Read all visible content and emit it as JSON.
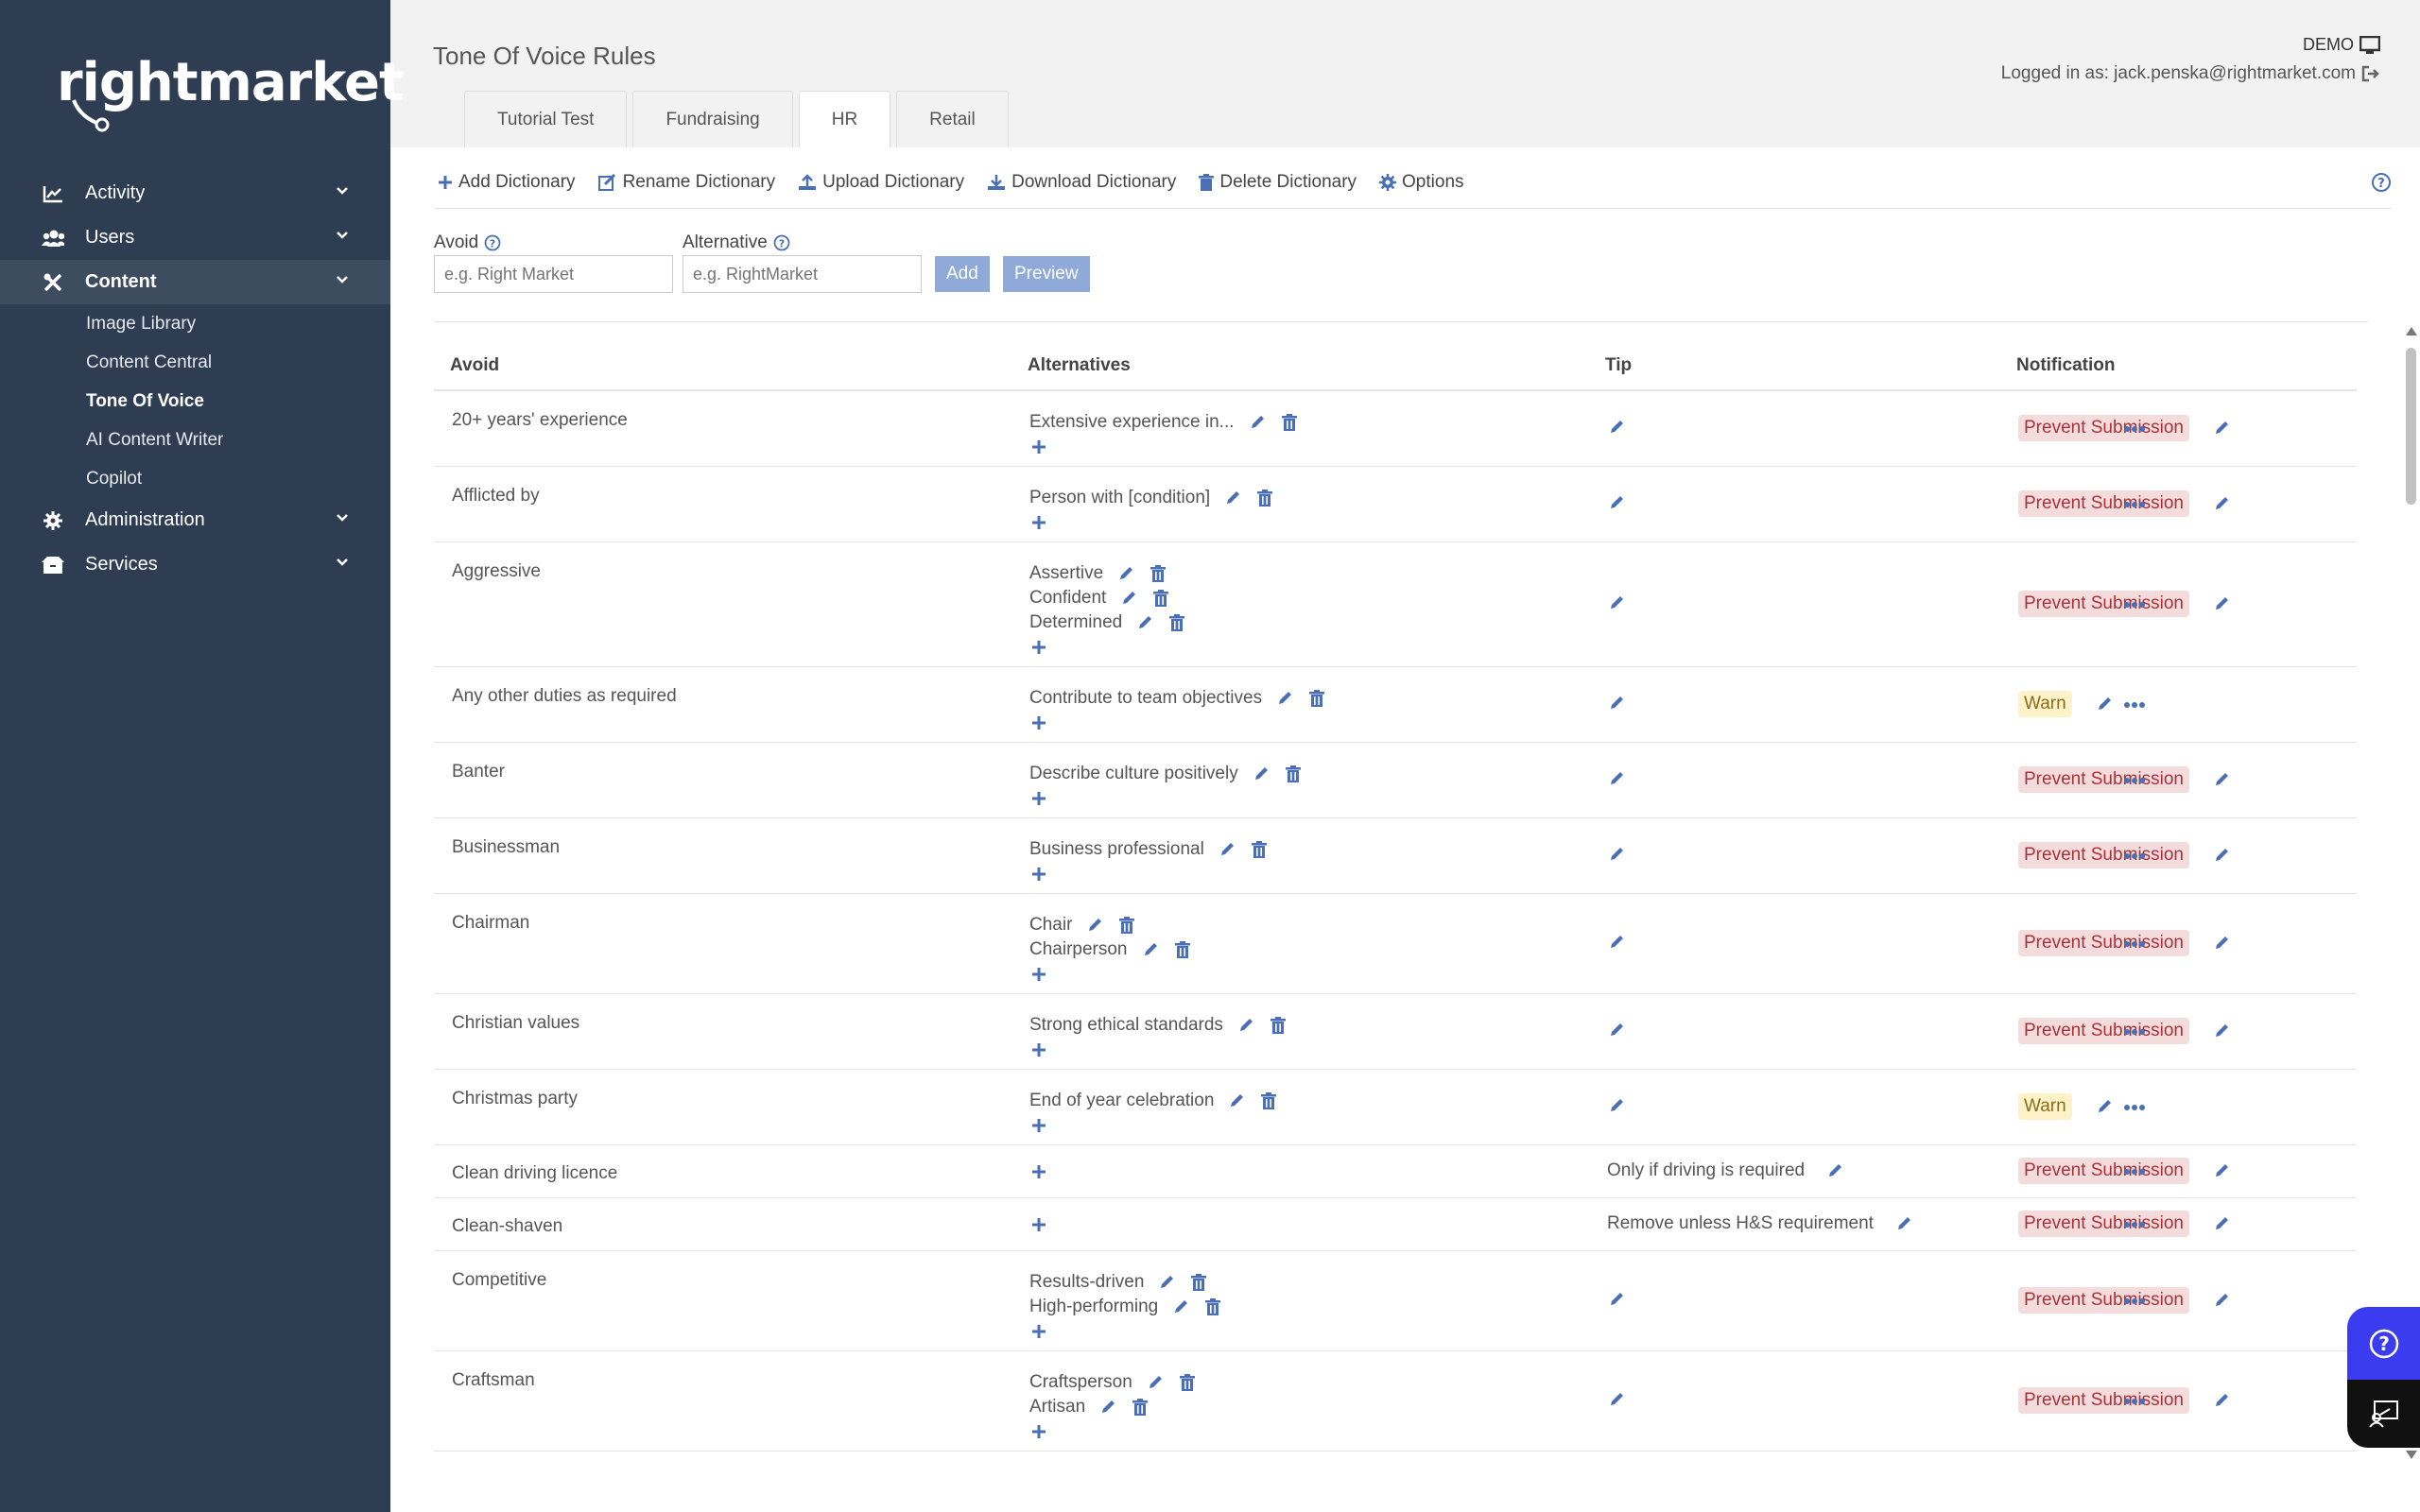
{
  "brand": {
    "logo_text": "rightmarket"
  },
  "sidebar": {
    "items": [
      {
        "label": "Activity",
        "icon": "chart-line-icon"
      },
      {
        "label": "Users",
        "icon": "users-icon"
      },
      {
        "label": "Content",
        "icon": "tools-icon",
        "active": true
      },
      {
        "label": "Administration",
        "icon": "gear-icon"
      },
      {
        "label": "Services",
        "icon": "box-icon"
      }
    ],
    "content_sub": [
      {
        "label": "Image Library"
      },
      {
        "label": "Content Central"
      },
      {
        "label": "Tone Of Voice",
        "active": true
      },
      {
        "label": "AI Content Writer"
      },
      {
        "label": "Copilot"
      }
    ]
  },
  "header": {
    "title": "Tone Of Voice Rules",
    "demo": "DEMO",
    "logged_in": "Logged in as: jack.penska@rightmarket.com"
  },
  "tabs": [
    {
      "label": "Tutorial Test"
    },
    {
      "label": "Fundraising"
    },
    {
      "label": "HR",
      "active": true
    },
    {
      "label": "Retail"
    }
  ],
  "toolbar": {
    "add": "Add Dictionary",
    "rename": "Rename Dictionary",
    "upload": "Upload Dictionary",
    "download": "Download Dictionary",
    "delete": "Delete Dictionary",
    "options": "Options"
  },
  "form": {
    "avoid_label": "Avoid",
    "avoid_placeholder": "e.g. Right Market",
    "alternative_label": "Alternative",
    "alternative_placeholder": "e.g. RightMarket",
    "add_button": "Add",
    "preview_button": "Preview"
  },
  "table": {
    "headers": {
      "avoid": "Avoid",
      "alternatives": "Alternatives",
      "tip": "Tip",
      "notification": "Notification"
    },
    "rows": [
      {
        "avoid": "20+ years' experience",
        "alternatives": [
          "Extensive experience in..."
        ],
        "tip": "",
        "notification": "Prevent Submission"
      },
      {
        "avoid": "Afflicted by",
        "alternatives": [
          "Person with [condition]"
        ],
        "tip": "",
        "notification": "Prevent Submission"
      },
      {
        "avoid": "Aggressive",
        "alternatives": [
          "Assertive",
          "Confident",
          "Determined"
        ],
        "tip": "",
        "notification": "Prevent Submission"
      },
      {
        "avoid": "Any other duties as required",
        "alternatives": [
          "Contribute to team objectives"
        ],
        "tip": "",
        "notification": "Warn"
      },
      {
        "avoid": "Banter",
        "alternatives": [
          "Describe culture positively"
        ],
        "tip": "",
        "notification": "Prevent Submission"
      },
      {
        "avoid": "Businessman",
        "alternatives": [
          "Business professional"
        ],
        "tip": "",
        "notification": "Prevent Submission"
      },
      {
        "avoid": "Chairman",
        "alternatives": [
          "Chair",
          "Chairperson"
        ],
        "tip": "",
        "notification": "Prevent Submission"
      },
      {
        "avoid": "Christian values",
        "alternatives": [
          "Strong ethical standards"
        ],
        "tip": "",
        "notification": "Prevent Submission"
      },
      {
        "avoid": "Christmas party",
        "alternatives": [
          "End of year celebration"
        ],
        "tip": "",
        "notification": "Warn"
      },
      {
        "avoid": "Clean driving licence",
        "alternatives": [],
        "tip": "Only if driving is required",
        "notification": "Prevent Submission"
      },
      {
        "avoid": "Clean-shaven",
        "alternatives": [],
        "tip": "Remove unless H&S requirement",
        "notification": "Prevent Submission"
      },
      {
        "avoid": "Competitive",
        "alternatives": [
          "Results-driven",
          "High-performing"
        ],
        "tip": "",
        "notification": "Prevent Submission"
      },
      {
        "avoid": "Craftsman",
        "alternatives": [
          "Craftsperson",
          "Artisan"
        ],
        "tip": "",
        "notification": "Prevent Submission"
      }
    ]
  },
  "colors": {
    "sidebar": "#2e3d52",
    "accent": "#4a6fb5",
    "prevent_bg": "#f5dcdc",
    "warn_bg": "#fdf2c8",
    "help_button": "#3b3bf0"
  }
}
